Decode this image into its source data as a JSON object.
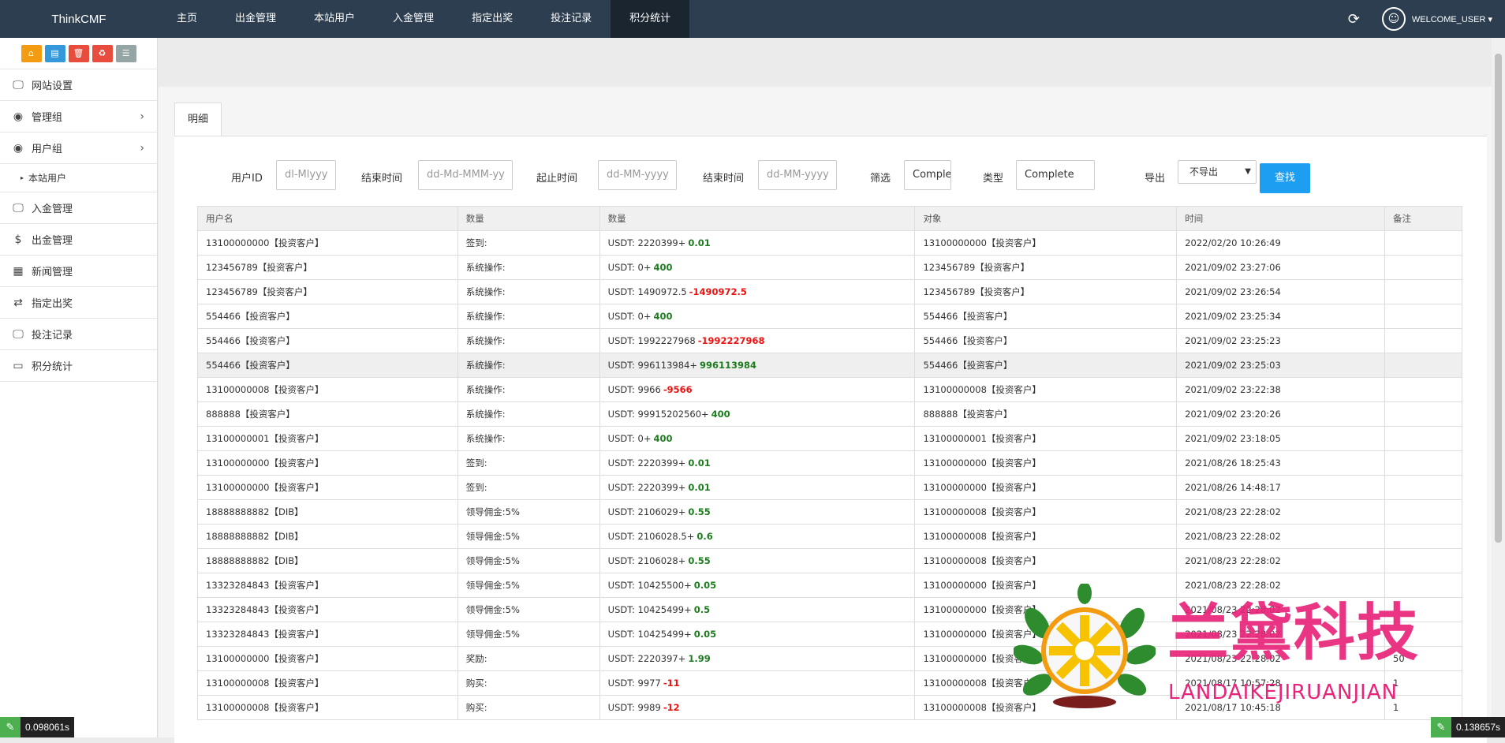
{
  "navbar": {
    "brand": "ThinkCMF",
    "items": [
      "主页",
      "出金管理",
      "本站用户",
      "入金管理",
      "指定出奖",
      "投注记录",
      "积分统计"
    ],
    "active_index": 6,
    "welcome": "WELCOME_USER ▾"
  },
  "sidebar": {
    "shortcuts": [
      {
        "icon": "home-icon",
        "color": "#f39c12"
      },
      {
        "icon": "file-icon",
        "color": "#3498db"
      },
      {
        "icon": "trash-icon",
        "color": "#e74c3c"
      },
      {
        "icon": "recycle-icon",
        "color": "#e74c3c"
      },
      {
        "icon": "list-icon",
        "color": "#95a5a6"
      }
    ],
    "items": [
      {
        "label": "网站设置",
        "icon": "monitor-icon"
      },
      {
        "label": "管理组",
        "icon": "user-circle-icon"
      },
      {
        "label": "用户组",
        "icon": "user-circle-icon"
      },
      {
        "label": "本站用户",
        "icon": "triangle-icon"
      },
      {
        "label": "入金管理",
        "icon": "monitor-icon"
      },
      {
        "label": "出金管理",
        "icon": "dollar-icon"
      },
      {
        "label": "新闻管理",
        "icon": "newspaper-icon"
      },
      {
        "label": "指定出奖",
        "icon": "exchange-icon"
      },
      {
        "label": "投注记录",
        "icon": "monitor-icon"
      },
      {
        "label": "积分统计",
        "icon": "visa-icon"
      }
    ]
  },
  "tab": "明细",
  "filters": {
    "user_id_label": "用户ID",
    "user_id_placeholder": "dl-Mlyyy",
    "end_time_label": "结束时间",
    "end_time_placeholder": "dd-Md-MMM-yy",
    "start_time_label": "起止时间",
    "start_time_placeholder": "dd-MM-yyyy",
    "end_time2_label": "结束时间",
    "end_time2_placeholder": "dd-MM-yyyy",
    "filter_label": "筛选",
    "filter_value": "Comple",
    "type_label": "类型",
    "type_value": "Complete",
    "export_label": "导出",
    "export_value": "不导出",
    "search_button": "查找"
  },
  "table": {
    "headers": [
      "用户名",
      "数量",
      "数量",
      "对象",
      "时间",
      "备注"
    ],
    "rows": [
      {
        "user": "13100000000【投资客户】",
        "op": "签到:",
        "base": "USDT: 2220399+",
        "delta": "0.01",
        "sign": "pos",
        "target": "13100000000【投资客户】",
        "time": "2022/02/20 10:26:49",
        "note": ""
      },
      {
        "user": "123456789【投资客户】",
        "op": "系统操作:",
        "base": "USDT: 0+",
        "delta": "400",
        "sign": "pos",
        "target": "123456789【投资客户】",
        "time": "2021/09/02 23:27:06",
        "note": ""
      },
      {
        "user": "123456789【投资客户】",
        "op": "系统操作:",
        "base": "USDT: 1490972.5",
        "delta": "-1490972.5",
        "sign": "neg",
        "target": "123456789【投资客户】",
        "time": "2021/09/02 23:26:54",
        "note": ""
      },
      {
        "user": "554466【投资客户】",
        "op": "系统操作:",
        "base": "USDT: 0+",
        "delta": "400",
        "sign": "pos",
        "target": "554466【投资客户】",
        "time": "2021/09/02 23:25:34",
        "note": ""
      },
      {
        "user": "554466【投资客户】",
        "op": "系统操作:",
        "base": "USDT: 1992227968",
        "delta": "-1992227968",
        "sign": "neg",
        "target": "554466【投资客户】",
        "time": "2021/09/02 23:25:23",
        "note": ""
      },
      {
        "user": "554466【投资客户】",
        "op": "系统操作:",
        "base": "USDT: 996113984+",
        "delta": "996113984",
        "sign": "pos",
        "target": "554466【投资客户】",
        "time": "2021/09/02 23:25:03",
        "note": "",
        "hl": true
      },
      {
        "user": "13100000008【投资客户】",
        "op": "系统操作:",
        "base": "USDT: 9966",
        "delta": "-9566",
        "sign": "neg",
        "target": "13100000008【投资客户】",
        "time": "2021/09/02 23:22:38",
        "note": ""
      },
      {
        "user": "888888【投资客户】",
        "op": "系统操作:",
        "base": "USDT: 99915202560+",
        "delta": "400",
        "sign": "pos",
        "target": "888888【投资客户】",
        "time": "2021/09/02 23:20:26",
        "note": ""
      },
      {
        "user": "13100000001【投资客户】",
        "op": "系统操作:",
        "base": "USDT: 0+",
        "delta": "400",
        "sign": "pos",
        "target": "13100000001【投资客户】",
        "time": "2021/09/02 23:18:05",
        "note": ""
      },
      {
        "user": "13100000000【投资客户】",
        "op": "签到:",
        "base": "USDT: 2220399+",
        "delta": "0.01",
        "sign": "pos",
        "target": "13100000000【投资客户】",
        "time": "2021/08/26 18:25:43",
        "note": ""
      },
      {
        "user": "13100000000【投资客户】",
        "op": "签到:",
        "base": "USDT: 2220399+",
        "delta": "0.01",
        "sign": "pos",
        "target": "13100000000【投资客户】",
        "time": "2021/08/26 14:48:17",
        "note": ""
      },
      {
        "user": "18888888882【DIB】",
        "op": "领导佣金:5%",
        "base": "USDT: 2106029+",
        "delta": "0.55",
        "sign": "pos",
        "target": "13100000008【投资客户】",
        "time": "2021/08/23 22:28:02",
        "note": ""
      },
      {
        "user": "18888888882【DIB】",
        "op": "领导佣金:5%",
        "base": "USDT: 2106028.5+",
        "delta": "0.6",
        "sign": "pos",
        "target": "13100000008【投资客户】",
        "time": "2021/08/23 22:28:02",
        "note": ""
      },
      {
        "user": "18888888882【DIB】",
        "op": "领导佣金:5%",
        "base": "USDT: 2106028+",
        "delta": "0.55",
        "sign": "pos",
        "target": "13100000008【投资客户】",
        "time": "2021/08/23 22:28:02",
        "note": ""
      },
      {
        "user": "13323284843【投资客户】",
        "op": "领导佣金:5%",
        "base": "USDT: 10425500+",
        "delta": "0.05",
        "sign": "pos",
        "target": "13100000000【投资客户】",
        "time": "2021/08/23 22:28:02",
        "note": ""
      },
      {
        "user": "13323284843【投资客户】",
        "op": "领导佣金:5%",
        "base": "USDT: 10425499+",
        "delta": "0.5",
        "sign": "pos",
        "target": "13100000000【投资客户】",
        "time": "2021/08/23 22:28:02",
        "note": ""
      },
      {
        "user": "13323284843【投资客户】",
        "op": "领导佣金:5%",
        "base": "USDT: 10425499+",
        "delta": "0.05",
        "sign": "pos",
        "target": "13100000000【投资客户】",
        "time": "2021/08/23 22:28:02",
        "note": ""
      },
      {
        "user": "13100000000【投资客户】",
        "op": "奖励:",
        "base": "USDT: 2220397+",
        "delta": "1.99",
        "sign": "pos",
        "target": "13100000000【投资客户】",
        "time": "2021/08/23 22:28:02",
        "note": "50"
      },
      {
        "user": "13100000008【投资客户】",
        "op": "购买:",
        "base": "USDT: 9977",
        "delta": "-11",
        "sign": "neg",
        "target": "13100000008【投资客户】",
        "time": "2021/08/17 10:57:28",
        "note": "1"
      },
      {
        "user": "13100000008【投资客户】",
        "op": "购买:",
        "base": "USDT: 9989",
        "delta": "-12",
        "sign": "neg",
        "target": "13100000008【投资客户】",
        "time": "2021/08/17 10:45:18",
        "note": "1"
      }
    ]
  },
  "watermark": {
    "cn": "兰黛科技",
    "en": "LANDAIKEJIRUANJIAN"
  },
  "timers": {
    "left": "0.098061s",
    "right": "0.138657s"
  }
}
